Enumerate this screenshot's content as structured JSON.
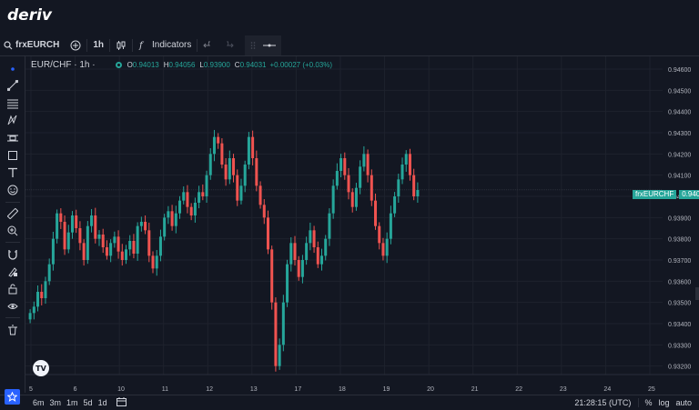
{
  "brand": {
    "logo": "deriv"
  },
  "toolbar": {
    "symbol": "frxEURCH",
    "timeframe": "1h",
    "indicators_label": "Indicators",
    "icons": [
      "search-icon",
      "add-circle-icon",
      "candlestick-icon",
      "function-icon",
      "undo-icon",
      "redo-icon",
      "drag-handle-icon",
      "horizontal-line-icon"
    ]
  },
  "legend": {
    "title": "EUR/CHF · 1h ·",
    "open_key": "O",
    "open": "0.94013",
    "high_key": "H",
    "high": "0.94056",
    "low_key": "L",
    "low": "0.93900",
    "close_key": "C",
    "close": "0.94031",
    "change": "+0.00027 (+0.03%)"
  },
  "price_tag": {
    "symbol": "frxEURCHF",
    "value": "0.94031"
  },
  "left_tools": [
    "cursor-dot-icon",
    "trend-line-icon",
    "fib-icon",
    "pattern-icon",
    "measure-icon",
    "rectangle-icon",
    "text-icon",
    "emoji-icon",
    "ruler-icon",
    "zoom-in-icon",
    "magnet-icon",
    "draw-lock-icon",
    "lock-icon",
    "eye-icon",
    "trash-icon"
  ],
  "bottom": {
    "ranges": [
      "6m",
      "3m",
      "1m",
      "5d",
      "1d"
    ],
    "time": "21:28:15 (UTC)",
    "percent": "%",
    "log": "log",
    "auto": "auto"
  },
  "colors": {
    "up": "#26a69a",
    "down": "#ef5350",
    "bg": "#131722",
    "grid": "#1e222d",
    "accent": "#2962ff"
  },
  "chart_data": {
    "type": "candlestick",
    "title": "EUR/CHF · 1h",
    "y_ticks": [
      "0.94600",
      "0.94500",
      "0.94400",
      "0.94300",
      "0.94200",
      "0.94100",
      "0.94000",
      "0.93900",
      "0.93800",
      "0.93700",
      "0.93600",
      "0.93500",
      "0.93400",
      "0.93300",
      "0.93200"
    ],
    "x_ticks": [
      "5",
      "6",
      "10",
      "11",
      "12",
      "13",
      "17",
      "18",
      "19",
      "20",
      "21",
      "22",
      "23",
      "24",
      "25"
    ],
    "ylim": [
      0.9316,
      0.9466
    ],
    "last_price": 0.94031,
    "path_note": "approximate hourly closes",
    "series": [
      {
        "name": "EUR/CHF",
        "closes": [
          0.9345,
          0.9348,
          0.9355,
          0.9352,
          0.936,
          0.9368,
          0.938,
          0.9392,
          0.9388,
          0.9375,
          0.9383,
          0.9391,
          0.9385,
          0.9378,
          0.937,
          0.9386,
          0.9391,
          0.938,
          0.9382,
          0.9376,
          0.9372,
          0.9378,
          0.9381,
          0.9374,
          0.937,
          0.9375,
          0.9379,
          0.9373,
          0.9386,
          0.9388,
          0.9384,
          0.9372,
          0.9366,
          0.9372,
          0.9381,
          0.939,
          0.9393,
          0.9386,
          0.9392,
          0.9398,
          0.9402,
          0.9395,
          0.9391,
          0.9397,
          0.9402,
          0.94,
          0.941,
          0.942,
          0.9428,
          0.9425,
          0.9415,
          0.9408,
          0.9418,
          0.941,
          0.9398,
          0.9405,
          0.9415,
          0.9428,
          0.9418,
          0.9405,
          0.9396,
          0.939,
          0.9375,
          0.935,
          0.932,
          0.933,
          0.935,
          0.9368,
          0.9378,
          0.937,
          0.9362,
          0.937,
          0.9378,
          0.9384,
          0.9376,
          0.9368,
          0.9372,
          0.938,
          0.9392,
          0.9405,
          0.9412,
          0.9418,
          0.941,
          0.9402,
          0.9395,
          0.9404,
          0.9414,
          0.942,
          0.941,
          0.9398,
          0.9386,
          0.9378,
          0.9372,
          0.938,
          0.9392,
          0.94,
          0.9408,
          0.9415,
          0.942,
          0.941,
          0.94,
          0.9403
        ]
      }
    ]
  }
}
